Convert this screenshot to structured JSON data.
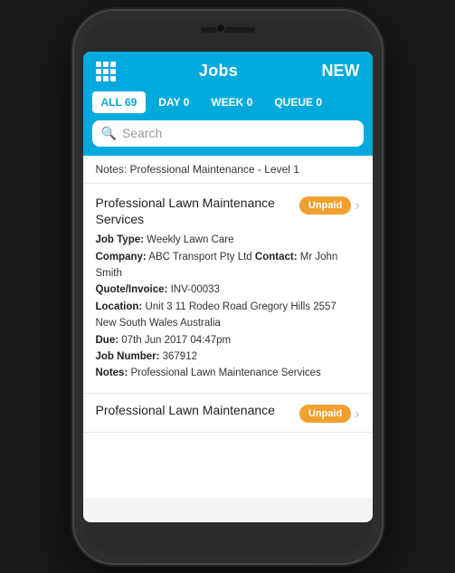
{
  "header": {
    "title": "Jobs",
    "new_label": "NEW"
  },
  "tabs": [
    {
      "id": "all",
      "label": "ALL 69",
      "active": true
    },
    {
      "id": "day",
      "label": "DAY 0",
      "active": false
    },
    {
      "id": "week",
      "label": "WEEK 0",
      "active": false
    },
    {
      "id": "queue",
      "label": "QUEUE 0",
      "active": false
    }
  ],
  "search": {
    "placeholder": "Search"
  },
  "notes_banner": "Notes: Professional Maintenance - Level 1",
  "jobs": [
    {
      "title": "Professional Lawn Maintenance Services",
      "badge": "Unpaid",
      "job_type_label": "Job Type:",
      "job_type": "Weekly Lawn Care",
      "company_label": "Company:",
      "company": "ABC Transport Pty Ltd",
      "contact_label": "Contact:",
      "contact": "Mr John Smith",
      "quote_label": "Quote/Invoice:",
      "quote": "INV-00033",
      "location_label": "Location:",
      "location": "Unit 3 11 Rodeo Road Gregory Hills 2557 New South Wales Australia",
      "due_label": "Due:",
      "due": "07th Jun 2017 04:47pm",
      "job_number_label": "Job Number:",
      "job_number": "367912",
      "notes_label": "Notes:",
      "notes": "Professional Lawn Maintenance Services"
    },
    {
      "title": "Professional Lawn Maintenance",
      "badge": "Unpaid"
    }
  ]
}
